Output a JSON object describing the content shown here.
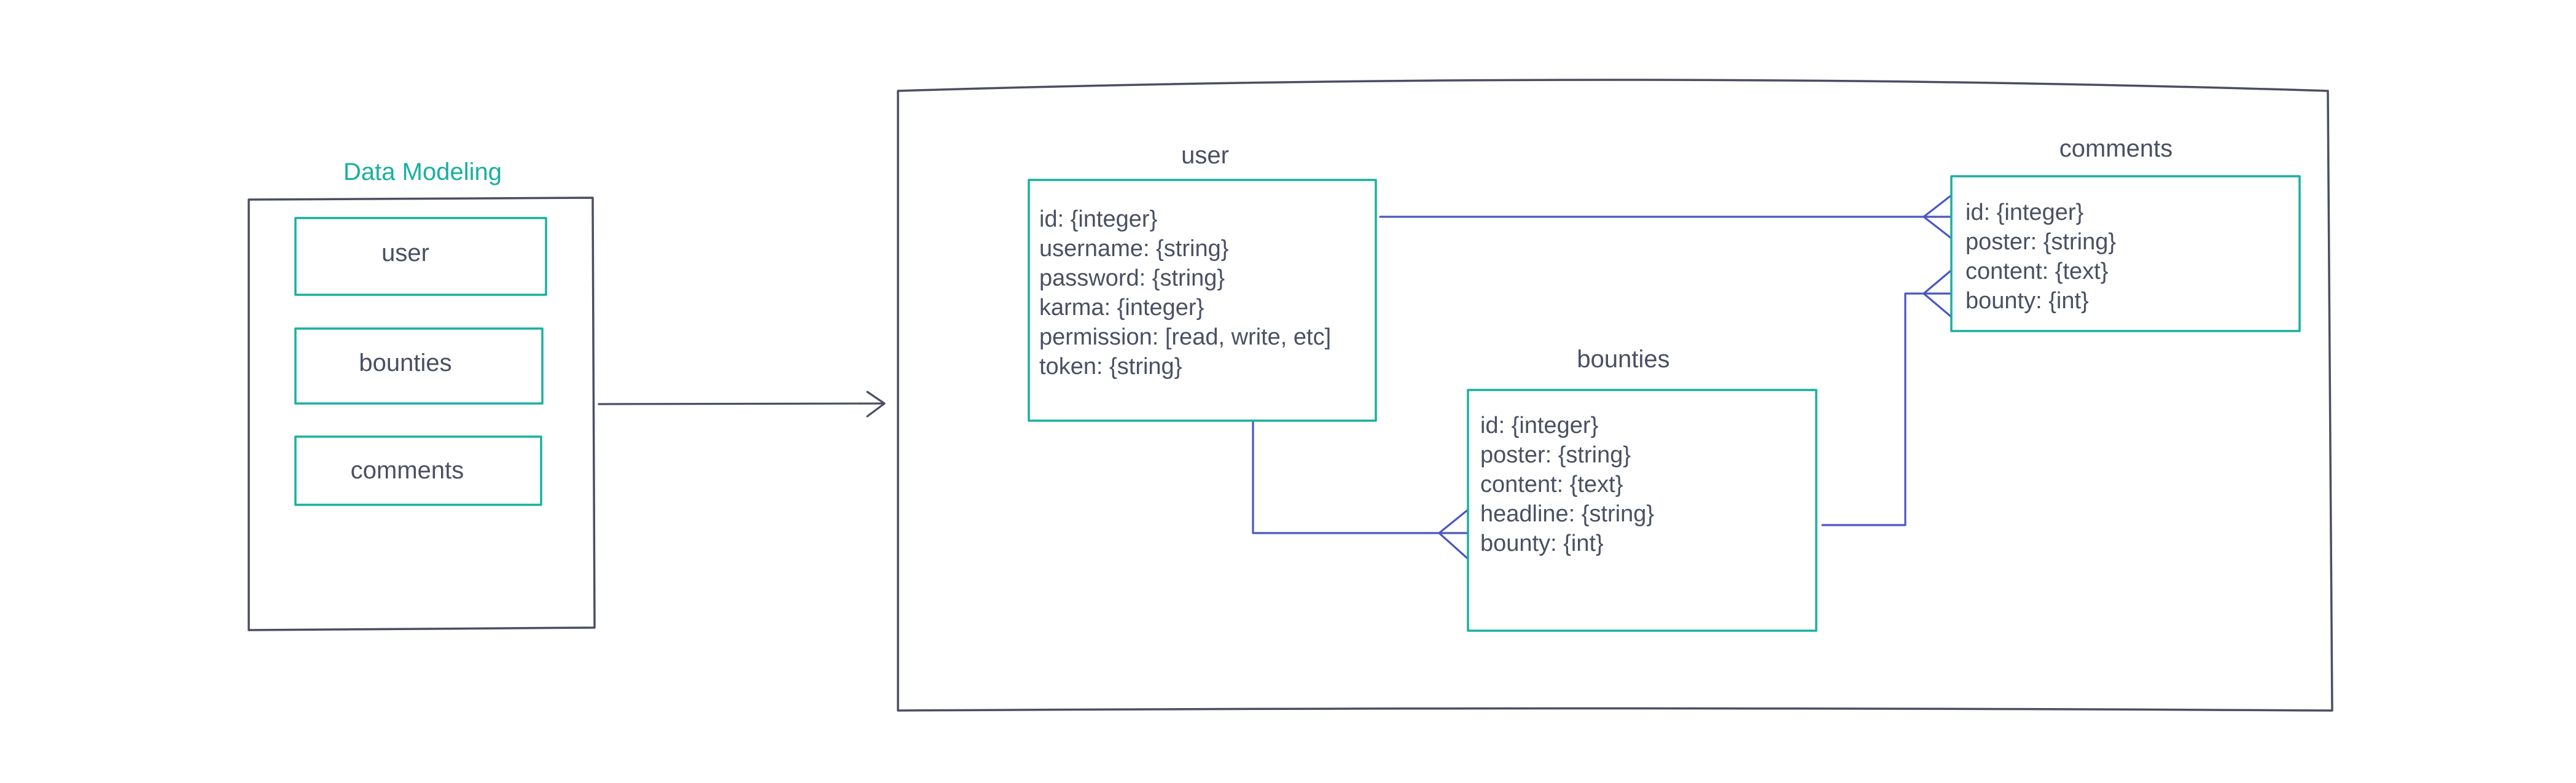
{
  "diagram": {
    "title": "Data Modeling",
    "sidebar_items": [
      "user",
      "bounties",
      "comments"
    ],
    "entities": {
      "user": {
        "name": "user",
        "fields": [
          "id: {integer}",
          "username: {string}",
          "password: {string}",
          "karma: {integer}",
          "permission: [read, write, etc]",
          "token: {string}"
        ]
      },
      "bounties": {
        "name": "bounties",
        "fields": [
          "id: {integer}",
          "poster: {string}",
          "content: {text}",
          "headline: {string}",
          "bounty: {int}"
        ]
      },
      "comments": {
        "name": "comments",
        "fields": [
          "id: {integer}",
          "poster: {string}",
          "content: {text}",
          "bounty: {int}"
        ]
      }
    },
    "relationships": [
      {
        "from": "user",
        "to": "comments",
        "type": "one-to-many"
      },
      {
        "from": "user",
        "to": "bounties",
        "type": "one-to-many"
      },
      {
        "from": "bounties",
        "to": "comments",
        "type": "one-to-many"
      }
    ],
    "colors": {
      "frame": "#4b4e63",
      "entity_border": "#18b09e",
      "connector": "#4a57c2",
      "text": "#4a5063",
      "title": "#18b09e"
    }
  }
}
